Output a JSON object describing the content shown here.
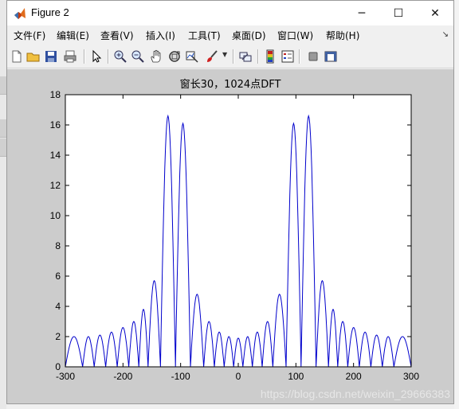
{
  "window": {
    "title": "Figure 2",
    "controls": {
      "minimize": "─",
      "maximize": "☐",
      "close": "✕"
    }
  },
  "menu": {
    "items": [
      "文件(F)",
      "编辑(E)",
      "查看(V)",
      "插入(I)",
      "工具(T)",
      "桌面(D)",
      "窗口(W)",
      "帮助(H)"
    ],
    "overflow_arrow": "↘"
  },
  "toolbar": {
    "icons": [
      "new-figure-icon",
      "open-folder-icon",
      "save-icon",
      "print-icon",
      "pointer-icon",
      "zoom-in-icon",
      "zoom-out-icon",
      "pan-hand-icon",
      "rotate-3d-icon",
      "data-cursor-icon",
      "brush-icon",
      "link-icon",
      "colorbar-icon",
      "legend-icon",
      "hide-plot-tools-icon",
      "show-plot-tools-icon"
    ]
  },
  "colors": {
    "line": "#0000cc",
    "figure_bg": "#cccccc",
    "axes_bg": "#ffffff"
  },
  "watermark": "https://blog.csdn.net/weixin_29666383",
  "chart_data": {
    "type": "line",
    "title": "窗长30，1024点DFT",
    "xlabel": "",
    "ylabel": "",
    "xlim": [
      -300,
      300
    ],
    "ylim": [
      0,
      18
    ],
    "xticks": [
      -300,
      -200,
      -100,
      0,
      100,
      200,
      300
    ],
    "yticks": [
      0,
      2,
      4,
      6,
      8,
      10,
      12,
      14,
      16,
      18
    ],
    "grid": false,
    "series": [
      {
        "description": "magnitude of DFT of 30-point windowed sum of sinusoids, symmetric about 0",
        "line_color": "#0000cc",
        "lobes": [
          {
            "center": -280,
            "peak": 2.0
          },
          {
            "center": -260,
            "peak": 2.0
          },
          {
            "center": -240,
            "peak": 2.1
          },
          {
            "center": -220,
            "peak": 2.3
          },
          {
            "center": -200,
            "peak": 2.6
          },
          {
            "center": -180,
            "peak": 3.0
          },
          {
            "center": -165,
            "peak": 3.8
          },
          {
            "center": -148,
            "peak": 5.7
          },
          {
            "center": -122,
            "peak": 16.6
          },
          {
            "center": -96,
            "peak": 16.1
          },
          {
            "center": -70,
            "peak": 4.8
          },
          {
            "center": -50,
            "peak": 3.0
          },
          {
            "center": -33,
            "peak": 2.3
          },
          {
            "center": -16,
            "peak": 2.0
          },
          {
            "center": 0,
            "peak": 1.9
          },
          {
            "center": 16,
            "peak": 2.0
          },
          {
            "center": 33,
            "peak": 2.3
          },
          {
            "center": 50,
            "peak": 3.0
          },
          {
            "center": 70,
            "peak": 4.8
          },
          {
            "center": 96,
            "peak": 16.1
          },
          {
            "center": 122,
            "peak": 16.6
          },
          {
            "center": 148,
            "peak": 5.7
          },
          {
            "center": 165,
            "peak": 3.8
          },
          {
            "center": 180,
            "peak": 3.0
          },
          {
            "center": 200,
            "peak": 2.6
          },
          {
            "center": 220,
            "peak": 2.3
          },
          {
            "center": 240,
            "peak": 2.1
          },
          {
            "center": 260,
            "peak": 2.0
          },
          {
            "center": 280,
            "peak": 2.0
          }
        ]
      }
    ]
  }
}
